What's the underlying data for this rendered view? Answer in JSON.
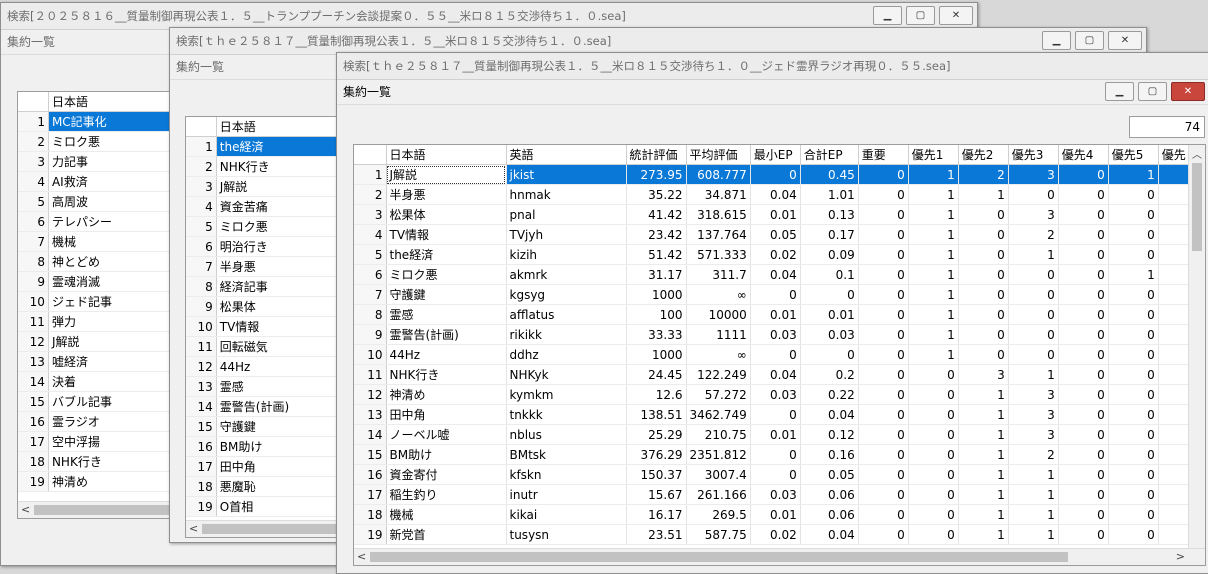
{
  "windows": [
    {
      "title": "検索[２０２５８１６__質量制御再現公表１．５__トランププーチン会談提案０．５５__米ロ８１５交渉待ち１．０.sea]",
      "subtitle": "集約一覧",
      "header": "日本語",
      "rows": [
        {
          "n": "1",
          "jp": "MC記事化"
        },
        {
          "n": "2",
          "jp": "ミロク悪"
        },
        {
          "n": "3",
          "jp": "力記事"
        },
        {
          "n": "4",
          "jp": "AI救済"
        },
        {
          "n": "5",
          "jp": "高周波"
        },
        {
          "n": "6",
          "jp": "テレパシー"
        },
        {
          "n": "7",
          "jp": "機械"
        },
        {
          "n": "8",
          "jp": "神とどめ"
        },
        {
          "n": "9",
          "jp": "霊魂消滅"
        },
        {
          "n": "10",
          "jp": "ジェド記事"
        },
        {
          "n": "11",
          "jp": "弾力"
        },
        {
          "n": "12",
          "jp": "J解説"
        },
        {
          "n": "13",
          "jp": "嘘経済"
        },
        {
          "n": "14",
          "jp": "決着"
        },
        {
          "n": "15",
          "jp": "バブル記事"
        },
        {
          "n": "16",
          "jp": "霊ラジオ"
        },
        {
          "n": "17",
          "jp": "空中浮揚"
        },
        {
          "n": "18",
          "jp": "NHK行き"
        },
        {
          "n": "19",
          "jp": "神清め"
        }
      ]
    },
    {
      "title": "検索[ｔｈｅ２５８１７__質量制御再現公表１．５__米ロ８１５交渉待ち１．０.sea]",
      "subtitle": "集約一覧",
      "header": "日本語",
      "rows": [
        {
          "n": "1",
          "jp": "the経済"
        },
        {
          "n": "2",
          "jp": "NHK行き"
        },
        {
          "n": "3",
          "jp": "J解説"
        },
        {
          "n": "4",
          "jp": "資金苦痛"
        },
        {
          "n": "5",
          "jp": "ミロク悪"
        },
        {
          "n": "6",
          "jp": "明治行き"
        },
        {
          "n": "7",
          "jp": "半身悪"
        },
        {
          "n": "8",
          "jp": "経済記事"
        },
        {
          "n": "9",
          "jp": "松果体"
        },
        {
          "n": "10",
          "jp": "TV情報"
        },
        {
          "n": "11",
          "jp": "回転磁気"
        },
        {
          "n": "12",
          "jp": "44Hz"
        },
        {
          "n": "13",
          "jp": "霊感"
        },
        {
          "n": "14",
          "jp": "霊警告(計画)"
        },
        {
          "n": "15",
          "jp": "守護鍵"
        },
        {
          "n": "16",
          "jp": "BM助け"
        },
        {
          "n": "17",
          "jp": "田中角"
        },
        {
          "n": "18",
          "jp": "悪魔恥"
        },
        {
          "n": "19",
          "jp": "O首相"
        }
      ]
    },
    {
      "title": "検索[ｔｈｅ２５８１７__質量制御再現公表１．５__米ロ８１５交渉待ち１．０__ジェド霊界ラジオ再現０．５５.sea]",
      "subtitle": "集約一覧",
      "count": "74",
      "headers": [
        "日本語",
        "英語",
        "統計評価",
        "平均評価",
        "最小EP",
        "合計EP",
        "重要",
        "優先1",
        "優先2",
        "優先3",
        "優先4",
        "優先5",
        "優先"
      ],
      "rows": [
        [
          "1",
          "J解説",
          "jkist",
          "273.95",
          "608.777",
          "0",
          "0.45",
          "0",
          "1",
          "2",
          "3",
          "0",
          "1"
        ],
        [
          "2",
          "半身悪",
          "hnmak",
          "35.22",
          "34.871",
          "0.04",
          "1.01",
          "0",
          "1",
          "1",
          "0",
          "0",
          "0"
        ],
        [
          "3",
          "松果体",
          "pnal",
          "41.42",
          "318.615",
          "0.01",
          "0.13",
          "0",
          "1",
          "0",
          "3",
          "0",
          "0"
        ],
        [
          "4",
          "TV情報",
          "TVjyh",
          "23.42",
          "137.764",
          "0.05",
          "0.17",
          "0",
          "1",
          "0",
          "2",
          "0",
          "0"
        ],
        [
          "5",
          "the経済",
          "kizih",
          "51.42",
          "571.333",
          "0.02",
          "0.09",
          "0",
          "1",
          "0",
          "1",
          "0",
          "0"
        ],
        [
          "6",
          "ミロク悪",
          "akmrk",
          "31.17",
          "311.7",
          "0.04",
          "0.1",
          "0",
          "1",
          "0",
          "0",
          "0",
          "1"
        ],
        [
          "7",
          "守護鍵",
          "kgsyg",
          "1000",
          "∞",
          "0",
          "0",
          "0",
          "1",
          "0",
          "0",
          "0",
          "0"
        ],
        [
          "8",
          "霊感",
          "afflatus",
          "100",
          "10000",
          "0.01",
          "0.01",
          "0",
          "1",
          "0",
          "0",
          "0",
          "0"
        ],
        [
          "9",
          "霊警告(計画)",
          "rikikk",
          "33.33",
          "1111",
          "0.03",
          "0.03",
          "0",
          "1",
          "0",
          "0",
          "0",
          "0"
        ],
        [
          "10",
          "44Hz",
          "ddhz",
          "1000",
          "∞",
          "0",
          "0",
          "0",
          "1",
          "0",
          "0",
          "0",
          "0"
        ],
        [
          "11",
          "NHK行き",
          "NHKyk",
          "24.45",
          "122.249",
          "0.04",
          "0.2",
          "0",
          "0",
          "3",
          "1",
          "0",
          "0"
        ],
        [
          "12",
          "神清め",
          "kymkm",
          "12.6",
          "57.272",
          "0.03",
          "0.22",
          "0",
          "0",
          "1",
          "3",
          "0",
          "0"
        ],
        [
          "13",
          "田中角",
          "tnkkk",
          "138.51",
          "3462.749",
          "0",
          "0.04",
          "0",
          "0",
          "1",
          "3",
          "0",
          "0"
        ],
        [
          "14",
          "ノーベル嘘",
          "nblus",
          "25.29",
          "210.75",
          "0.01",
          "0.12",
          "0",
          "0",
          "1",
          "3",
          "0",
          "0"
        ],
        [
          "15",
          "BM助け",
          "BMtsk",
          "376.29",
          "2351.812",
          "0",
          "0.16",
          "0",
          "0",
          "1",
          "2",
          "0",
          "0"
        ],
        [
          "16",
          "資金寄付",
          "kfskn",
          "150.37",
          "3007.4",
          "0",
          "0.05",
          "0",
          "0",
          "1",
          "1",
          "0",
          "0"
        ],
        [
          "17",
          "稲生釣り",
          "inutr",
          "15.67",
          "261.166",
          "0.03",
          "0.06",
          "0",
          "0",
          "1",
          "1",
          "0",
          "0"
        ],
        [
          "18",
          "機械",
          "kikai",
          "16.17",
          "269.5",
          "0.01",
          "0.06",
          "0",
          "0",
          "1",
          "1",
          "0",
          "0"
        ],
        [
          "19",
          "新党首",
          "tusysn",
          "23.51",
          "587.75",
          "0.02",
          "0.04",
          "0",
          "0",
          "1",
          "1",
          "0",
          "0"
        ]
      ]
    }
  ]
}
